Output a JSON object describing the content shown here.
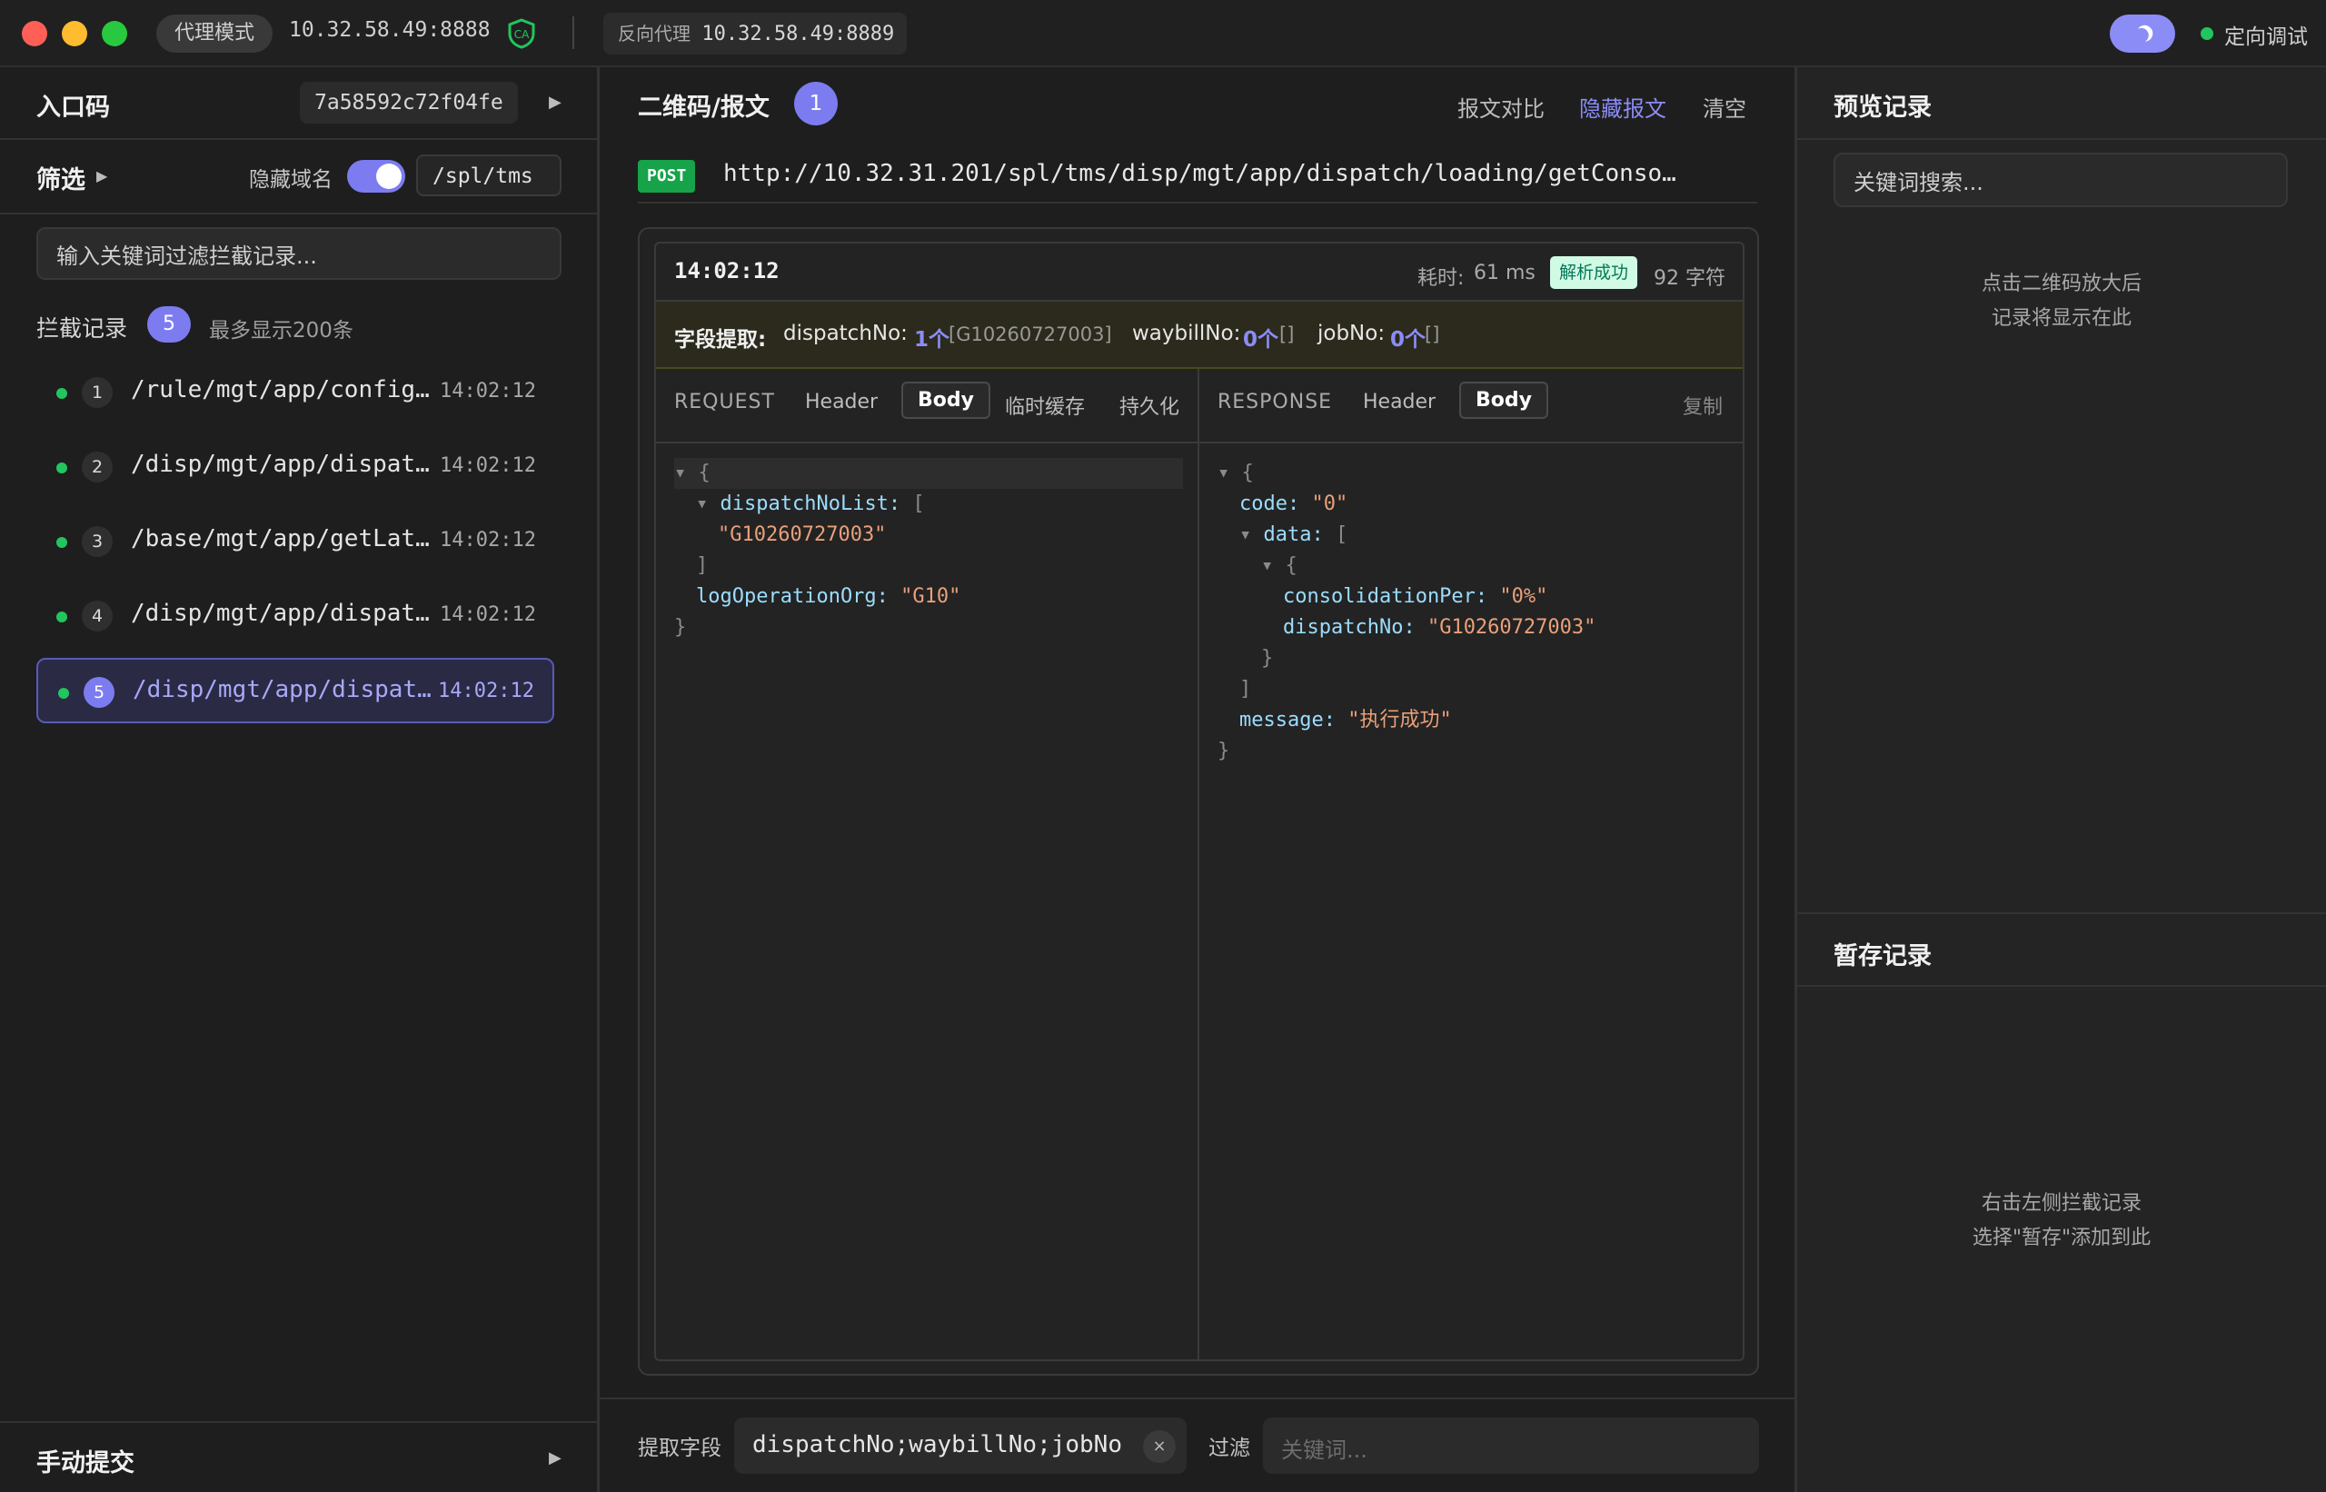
{
  "titlebar": {
    "mode_label": "代理模式",
    "proxy_addr": "10.32.58.49:8888",
    "reverse_label": "反向代理",
    "reverse_addr": "10.32.58.49:8889",
    "debug_label": "定向调试",
    "accent_color": "#7c7cf0"
  },
  "left": {
    "entry_title": "入口码",
    "entry_code": "7a58592c72f04fe",
    "filter_title": "筛选",
    "hide_domain_label": "隐藏域名",
    "hide_domain_on": true,
    "path_prefix": "/spl/tms",
    "search_placeholder": "输入关键词过滤拦截记录...",
    "records_title": "拦截记录",
    "records_count": "5",
    "records_limit": "最多显示200条",
    "records": [
      {
        "num": "1",
        "path": "/rule/mgt/app/configA…",
        "time": "14:02:12"
      },
      {
        "num": "2",
        "path": "/disp/mgt/app/dispatc…",
        "time": "14:02:12"
      },
      {
        "num": "3",
        "path": "/base/mgt/app/getLate…",
        "time": "14:02:12"
      },
      {
        "num": "4",
        "path": "/disp/mgt/app/dispatc…",
        "time": "14:02:12"
      },
      {
        "num": "5",
        "path": "/disp/mgt/app/dispatc…",
        "time": "14:02:12"
      }
    ],
    "selected_record": 5,
    "manual_submit": "手动提交"
  },
  "main": {
    "title": "二维码/报文",
    "count": "1",
    "compare": "报文对比",
    "hide": "隐藏报文",
    "clear": "清空",
    "method": "POST",
    "url": "http://10.32.31.201/spl/tms/disp/mgt/app/dispatch/loading/getConso…",
    "time": "14:02:12",
    "elapsed_label": "耗时:",
    "elapsed": "61 ms",
    "parse_status": "解析成功",
    "chars": "92 字符",
    "extract_label": "字段提取:",
    "extract": [
      {
        "name": "dispatchNo:",
        "count": "1个",
        "values": "[G10260727003]"
      },
      {
        "name": "waybillNo:",
        "count": "0个",
        "values": "[]"
      },
      {
        "name": "jobNo:",
        "count": "0个",
        "values": "[]"
      }
    ],
    "request_tabs": {
      "title": "REQUEST",
      "header": "Header",
      "body": "Body",
      "cache": "临时缓存",
      "persist": "持久化"
    },
    "response_tabs": {
      "title": "RESPONSE",
      "header": "Header",
      "body": "Body",
      "copy": "复制"
    },
    "request_json": {
      "key1": "dispatchNoList:",
      "val1": "\"G10260727003\"",
      "key2": "logOperationOrg:",
      "val2": "\"G10\""
    },
    "response_json": {
      "code_key": "code:",
      "code_val": "\"0\"",
      "data_key": "data:",
      "per_key": "consolidationPer:",
      "per_val": "\"0%\"",
      "dno_key": "dispatchNo:",
      "dno_val": "\"G10260727003\"",
      "msg_key": "message:",
      "msg_val": "\"执行成功\""
    },
    "footer": {
      "extract_label": "提取字段",
      "extract_value": "dispatchNo;waybillNo;jobNo",
      "filter_label": "过滤",
      "filter_placeholder": "关键词..."
    }
  },
  "right": {
    "preview_title": "预览记录",
    "search_placeholder": "关键词搜索...",
    "preview_hint_1": "点击二维码放大后",
    "preview_hint_2": "记录将显示在此",
    "stash_title": "暂存记录",
    "stash_hint_1": "右击左侧拦截记录",
    "stash_hint_2": "选择\"暂存\"添加到此"
  }
}
